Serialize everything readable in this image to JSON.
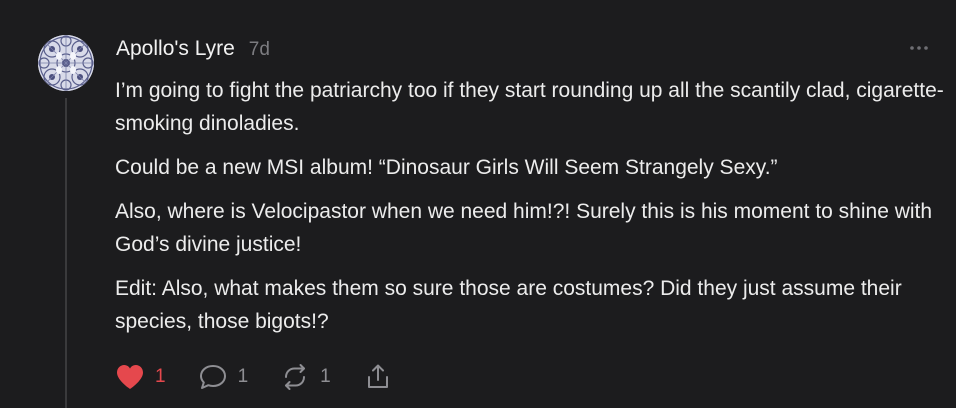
{
  "comment": {
    "author": "Apollo's Lyre",
    "timestamp": "7d",
    "paragraphs": [
      "I’m going to fight the patriarchy too if they start rounding up all the scantily clad, cigarette-smoking dinoladies.",
      "Could be a new MSI album! “Dinosaur Girls Will Seem Strangely Sexy.”",
      "Also, where is Velocipastor when we need him!?! Surely this is his moment to shine with God’s divine justice!",
      "Edit: Also, what makes them so sure those are costumes? Did they just assume their species, those bigots!?"
    ],
    "actions": {
      "likes": "1",
      "replies": "1",
      "restacks": "1"
    },
    "icons": {
      "like": "heart-icon",
      "reply": "speech-bubble-icon",
      "restack": "restack-arrows-icon",
      "share": "share-upload-icon",
      "more": "more-horizontal-icon"
    },
    "colors": {
      "background": "#1c1c1e",
      "like_active": "#e5484d",
      "muted": "#8e8e93"
    }
  }
}
